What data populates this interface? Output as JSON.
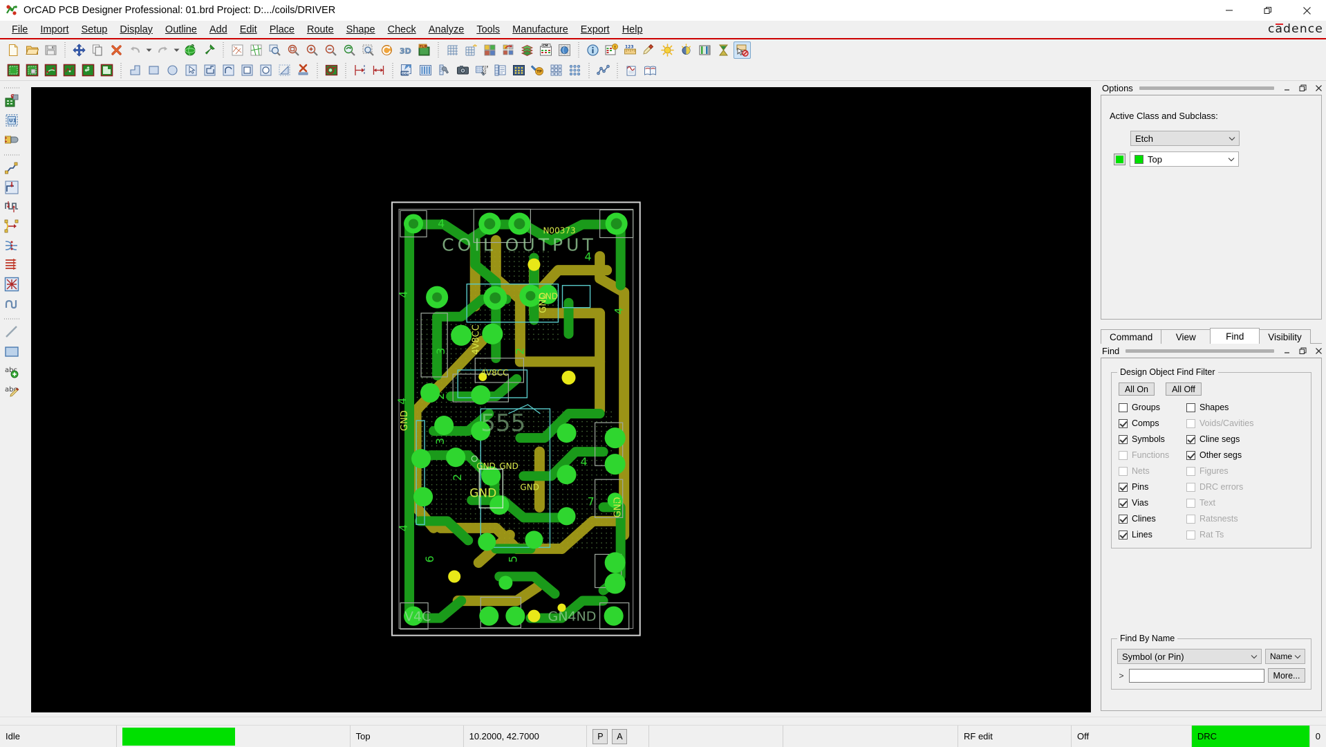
{
  "window": {
    "title": "OrCAD PCB Designer Professional: 01.brd  Project: D:.../coils/DRIVER",
    "app_icon": "orcad-logo-icon",
    "minimize_label": "Minimize",
    "restore_label": "Restore",
    "close_label": "Close",
    "brand": "cadence",
    "brand_accent": "#e21f26"
  },
  "menubar": {
    "items": [
      {
        "label": "File",
        "mnemonic": "F"
      },
      {
        "label": "Import",
        "mnemonic": "I"
      },
      {
        "label": "Setup",
        "mnemonic": "u"
      },
      {
        "label": "Display",
        "mnemonic": "D"
      },
      {
        "label": "Outline",
        "mnemonic": "O"
      },
      {
        "label": "Add",
        "mnemonic": "A"
      },
      {
        "label": "Edit",
        "mnemonic": "E"
      },
      {
        "label": "Place",
        "mnemonic": "P"
      },
      {
        "label": "Route",
        "mnemonic": "R"
      },
      {
        "label": "Shape",
        "mnemonic": "S"
      },
      {
        "label": "Check",
        "mnemonic": "C"
      },
      {
        "label": "Analyze",
        "mnemonic": "y"
      },
      {
        "label": "Tools",
        "mnemonic": "T"
      },
      {
        "label": "Manufacture",
        "mnemonic": "M"
      },
      {
        "label": "Export",
        "mnemonic": "x"
      },
      {
        "label": "Help",
        "mnemonic": "H"
      }
    ]
  },
  "toolbar_main": {
    "groups": [
      {
        "buttons": [
          {
            "name": "new-file-icon",
            "tip": "New"
          },
          {
            "name": "open-file-icon",
            "tip": "Open"
          },
          {
            "name": "save-file-icon",
            "tip": "Save"
          }
        ]
      },
      {
        "buttons": [
          {
            "name": "move-icon",
            "tip": "Move"
          },
          {
            "name": "copy-icon",
            "tip": "Copy"
          },
          {
            "name": "delete-icon",
            "tip": "Delete"
          },
          {
            "name": "undo-icon",
            "tip": "Undo",
            "has_dropdown": true
          },
          {
            "name": "redo-icon",
            "tip": "Redo",
            "has_dropdown": true
          },
          {
            "name": "color-globe-icon",
            "tip": "Color / Visibility"
          },
          {
            "name": "pin-icon",
            "tip": "Pin"
          }
        ]
      },
      {
        "buttons": [
          {
            "name": "zoom-fit-icon",
            "tip": "Zoom Fit"
          },
          {
            "name": "zoom-world-icon",
            "tip": "Zoom World"
          },
          {
            "name": "zoom-by-points-icon",
            "tip": "Zoom By Points"
          },
          {
            "name": "zoom-area-icon",
            "tip": "Zoom Area"
          },
          {
            "name": "zoom-in-icon",
            "tip": "Zoom In"
          },
          {
            "name": "zoom-out-icon",
            "tip": "Zoom Out"
          },
          {
            "name": "zoom-previous-icon",
            "tip": "Zoom Previous"
          },
          {
            "name": "zoom-selection-icon",
            "tip": "Zoom Selection"
          },
          {
            "name": "refresh-icon",
            "tip": "Redraw"
          },
          {
            "name": "view-3d-icon",
            "tip": "3D View"
          },
          {
            "name": "flip-design-icon",
            "tip": "Flip Design"
          }
        ]
      },
      {
        "buttons": [
          {
            "name": "grid-toggle-icon",
            "tip": "Grid Toggle"
          },
          {
            "name": "grid-snap-icon",
            "tip": "Snap to Grid"
          },
          {
            "name": "color-palette-icon",
            "tip": "Color Palette"
          },
          {
            "name": "subclass-icon",
            "tip": "Subclass"
          },
          {
            "name": "layers-icon",
            "tip": "Layers"
          },
          {
            "name": "cm-matrix-icon",
            "tip": "Constraint Matrix"
          },
          {
            "name": "global-view-icon",
            "tip": "Global View"
          }
        ]
      },
      {
        "buttons": [
          {
            "name": "info-icon",
            "tip": "Show Element"
          },
          {
            "name": "constraint-manager-icon",
            "tip": "Constraint Manager"
          },
          {
            "name": "measure-icon",
            "tip": "Measure"
          },
          {
            "name": "highlight-icon",
            "tip": "Highlight"
          },
          {
            "name": "brightness-icon",
            "tip": "Brightness"
          },
          {
            "name": "contrast-icon",
            "tip": "Contrast"
          },
          {
            "name": "layer-bars-icon",
            "tip": "Layer Bars"
          },
          {
            "name": "hourglass-icon",
            "tip": "Delay"
          },
          {
            "name": "dehighlight-icon",
            "tip": "Dehighlight",
            "active": true
          }
        ]
      }
    ]
  },
  "toolbar_second": {
    "groups": [
      {
        "buttons": [
          {
            "name": "shape-add-rect-icon",
            "tip": "Shape Add Rect"
          },
          {
            "name": "shape-select-icon",
            "tip": "Shape Select"
          },
          {
            "name": "shape-edit-boundary-icon",
            "tip": "Shape Edit Boundary"
          },
          {
            "name": "shape-manual-void-icon",
            "tip": "Shape Manual Void"
          },
          {
            "name": "shape-compose-icon",
            "tip": "Compose Shape"
          },
          {
            "name": "shape-decompose-icon",
            "tip": "Decompose Shape"
          }
        ]
      },
      {
        "buttons": [
          {
            "name": "polygon-draw-icon",
            "tip": "Add Polygon"
          },
          {
            "name": "rectangle-draw-icon",
            "tip": "Add Rectangle"
          },
          {
            "name": "circle-draw-icon",
            "tip": "Add Circle"
          },
          {
            "name": "select-arrow-icon",
            "tip": "Select"
          },
          {
            "name": "offset-shape-icon",
            "tip": "Offset Shape"
          },
          {
            "name": "arc-draw-icon",
            "tip": "Add Arc"
          },
          {
            "name": "square-fill-icon",
            "tip": "Filled Rectangle"
          },
          {
            "name": "circle-fill-icon",
            "tip": "Filled Circle"
          },
          {
            "name": "shape-outline-icon",
            "tip": "Shape Outline"
          },
          {
            "name": "delete-shape-icon",
            "tip": "Delete Shape"
          }
        ]
      },
      {
        "buttons": [
          {
            "name": "board-geometry-icon",
            "tip": "Board Geometry"
          }
        ]
      },
      {
        "buttons": [
          {
            "name": "dimension-left-icon",
            "tip": "Datum Dimension"
          },
          {
            "name": "dimension-linear-icon",
            "tip": "Linear Dimension"
          }
        ]
      },
      {
        "buttons": [
          {
            "name": "odb-export-icon",
            "tip": "ODB++ Export"
          },
          {
            "name": "artwork-icon",
            "tip": "Artwork Films"
          },
          {
            "name": "drill-legend-icon",
            "tip": "Drill Legend"
          },
          {
            "name": "photoplot-icon",
            "tip": "Photoplot"
          },
          {
            "name": "nc-drill-icon",
            "tip": "NC Drill"
          },
          {
            "name": "reports-icon",
            "tip": "Reports"
          },
          {
            "name": "testprep-icon",
            "tip": "Testprep"
          },
          {
            "name": "testpoint-icon",
            "tip": "Add Test Point"
          },
          {
            "name": "panel-array-icon",
            "tip": "Panel Array"
          },
          {
            "name": "pad-array-icon",
            "tip": "Pad Array"
          }
        ]
      },
      {
        "buttons": [
          {
            "name": "signal-analysis-icon",
            "tip": "Signal Analysis"
          }
        ]
      },
      {
        "buttons": [
          {
            "name": "sigxplorer-icon",
            "tip": "SigXplorer"
          },
          {
            "name": "library-browser-icon",
            "tip": "Library Browser"
          }
        ]
      }
    ]
  },
  "left_rail": {
    "groups": [
      {
        "buttons": [
          {
            "name": "place-manual-icon",
            "tip": "Place Manual"
          },
          {
            "name": "place-quickplace-icon",
            "tip": "Quickplace"
          },
          {
            "name": "swap-components-icon",
            "tip": "Swap Components"
          }
        ]
      },
      {
        "buttons": [
          {
            "name": "add-connect-icon",
            "tip": "Add Connect"
          },
          {
            "name": "slide-icon",
            "tip": "Slide"
          },
          {
            "name": "delay-tune-icon",
            "tip": "Delay Tune"
          },
          {
            "name": "custom-smooth-icon",
            "tip": "Custom Smooth"
          },
          {
            "name": "fanout-icon",
            "tip": "Create Fanout"
          },
          {
            "name": "bus-route-icon",
            "tip": "Bus Route"
          },
          {
            "name": "auto-route-icon",
            "tip": "Auto Route"
          },
          {
            "name": "contour-route-icon",
            "tip": "Contour Route"
          }
        ]
      },
      {
        "buttons": [
          {
            "name": "add-line-icon",
            "tip": "Add Line"
          },
          {
            "name": "add-rect-icon",
            "tip": "Add Rectangle"
          },
          {
            "name": "add-text-icon",
            "tip": "Add Text"
          },
          {
            "name": "edit-text-icon",
            "tip": "Edit Text"
          }
        ]
      }
    ]
  },
  "options_panel": {
    "title": "Options",
    "minimize_icon": "panel-minimize-icon",
    "float_icon": "panel-float-icon",
    "close_icon": "panel-close-icon",
    "section_label": "Active Class and Subclass:",
    "class_value": "Etch",
    "subclass_value": "Top",
    "subclass_color": "#00e000",
    "visibility_swatch_color": "#00e000"
  },
  "bottom_tabs": {
    "items": [
      {
        "label": "Command",
        "name": "tab-command",
        "selected": false
      },
      {
        "label": "View",
        "name": "tab-view",
        "selected": false
      },
      {
        "label": "Find",
        "name": "tab-find",
        "selected": true
      },
      {
        "label": "Visibility",
        "name": "tab-visibility",
        "selected": false
      }
    ]
  },
  "find_panel": {
    "title": "Find",
    "filter_group_title": "Design Object Find Filter",
    "all_on_label": "All On",
    "all_off_label": "All Off",
    "filters_left": [
      {
        "label": "Groups",
        "checked": false,
        "enabled": true
      },
      {
        "label": "Comps",
        "checked": true,
        "enabled": true
      },
      {
        "label": "Symbols",
        "checked": true,
        "enabled": true
      },
      {
        "label": "Functions",
        "checked": false,
        "enabled": false
      },
      {
        "label": "Nets",
        "checked": false,
        "enabled": false
      },
      {
        "label": "Pins",
        "checked": true,
        "enabled": true
      },
      {
        "label": "Vias",
        "checked": true,
        "enabled": true
      },
      {
        "label": "Clines",
        "checked": true,
        "enabled": true
      },
      {
        "label": "Lines",
        "checked": true,
        "enabled": true
      }
    ],
    "filters_right": [
      {
        "label": "Shapes",
        "checked": false,
        "enabled": true
      },
      {
        "label": "Voids/Cavities",
        "checked": false,
        "enabled": false
      },
      {
        "label": "Cline segs",
        "checked": true,
        "enabled": true
      },
      {
        "label": "Other segs",
        "checked": true,
        "enabled": true
      },
      {
        "label": "Figures",
        "checked": false,
        "enabled": false
      },
      {
        "label": "DRC errors",
        "checked": false,
        "enabled": false
      },
      {
        "label": "Text",
        "checked": false,
        "enabled": false
      },
      {
        "label": "Ratsnests",
        "checked": false,
        "enabled": false
      },
      {
        "label": "Rat Ts",
        "checked": false,
        "enabled": false
      }
    ],
    "find_by_name_title": "Find By Name",
    "object_type_value": "Symbol (or Pin)",
    "match_mode_value": "Name",
    "name_input_value": "",
    "expand_chevron": ">",
    "more_label": "More..."
  },
  "statusbar": {
    "mode": "Idle",
    "progress_color": "#00e000",
    "layer": "Top",
    "coordinates": "10.2000, 42.7000",
    "pick_button": "P",
    "app_button": "A",
    "rf_label": "RF edit",
    "rf_value": "Off",
    "drc_label": "DRC",
    "drc_color": "#00e000",
    "drc_count": "0"
  },
  "canvas": {
    "background": "#000000",
    "board": {
      "outline_color": "#d8d8d8",
      "top_etch_color": "#18a018",
      "bottom_etch_color": "#a8a018",
      "pad_color": "#2fd92f",
      "silkscreen_color": "#9fd9a0",
      "assembly_color": "#6fd8d8",
      "labels": [
        "COIL OUTPUT",
        "N00373",
        "GND",
        "GND",
        "GND",
        "GND",
        "4",
        "4",
        "4",
        "4",
        "4",
        "4",
        "7",
        "2",
        "3",
        "5",
        "V4C",
        "GN4ND",
        "555"
      ]
    }
  }
}
